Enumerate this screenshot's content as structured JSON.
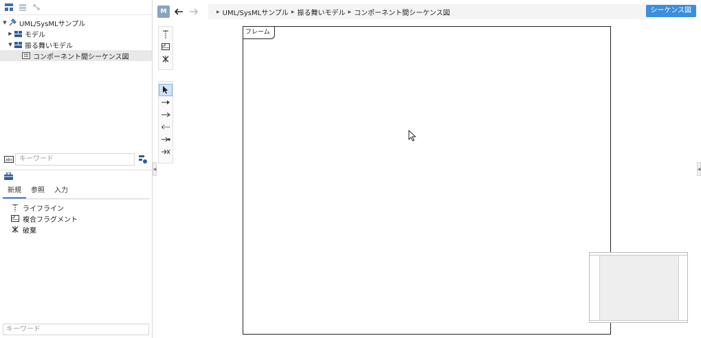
{
  "tree": {
    "root": "UML/SysMLサンプル",
    "items": [
      {
        "label": "モデル",
        "expanded": false
      },
      {
        "label": "振る舞いモデル",
        "expanded": true
      },
      {
        "label": "コンポーネント間シーケンス図",
        "selected": true
      }
    ]
  },
  "search": {
    "placeholder": "キーワード"
  },
  "palette": {
    "tabs": [
      "新規",
      "参照",
      "入力"
    ],
    "active_tab": "新規",
    "items": [
      "ライフライン",
      "複合フラグメント",
      "破棄"
    ]
  },
  "bottom_search": {
    "placeholder": "キーワード"
  },
  "topbar": {
    "model_badge": "M",
    "breadcrumb": [
      "UML/SysMLサンプル",
      "振る舞いモデル",
      "コンポーネント間シーケンス図"
    ],
    "diagram_type_button": "シーケンス図"
  },
  "canvas": {
    "frame_label": "フレーム"
  },
  "colors": {
    "accent": "#3b8fdc",
    "badge": "#8aa3c2",
    "selection": "#e8e8e8"
  }
}
